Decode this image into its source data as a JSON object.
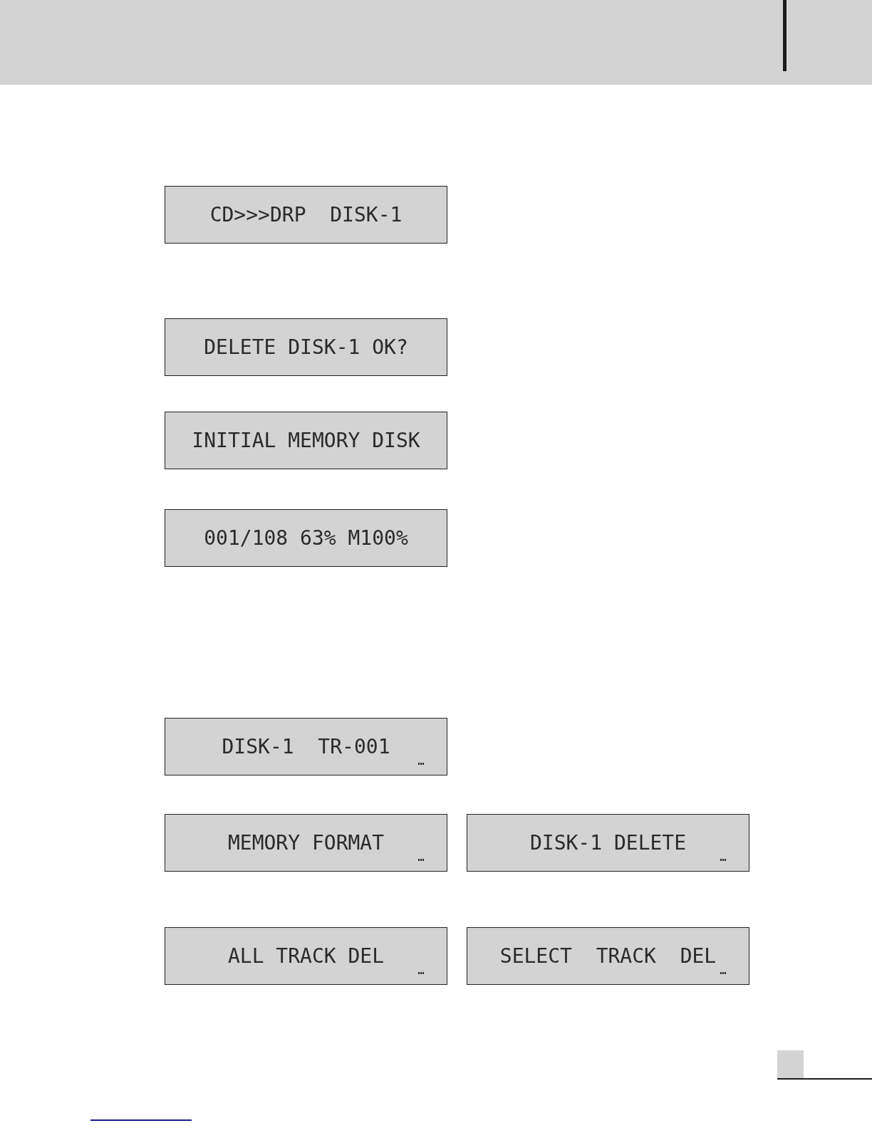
{
  "rows": [
    [
      {
        "text": "CD>>>DRP  DISK-1",
        "cursor": false
      }
    ],
    [
      {
        "text": "DELETE DISK-1 OK?",
        "cursor": false
      }
    ],
    [
      {
        "text": "INITIAL MEMORY DISK",
        "cursor": false
      }
    ],
    [
      {
        "text": "001/108 63% M100%",
        "cursor": false
      }
    ],
    [
      {
        "text": "DISK-1  TR-001",
        "cursor": true
      }
    ],
    [
      {
        "text": "MEMORY FORMAT",
        "cursor": true
      },
      {
        "text": "DISK-1 DELETE",
        "cursor": true
      }
    ],
    [
      {
        "text": "ALL TRACK DEL",
        "cursor": true
      },
      {
        "text": "SELECT  TRACK  DEL",
        "cursor": true
      }
    ]
  ]
}
